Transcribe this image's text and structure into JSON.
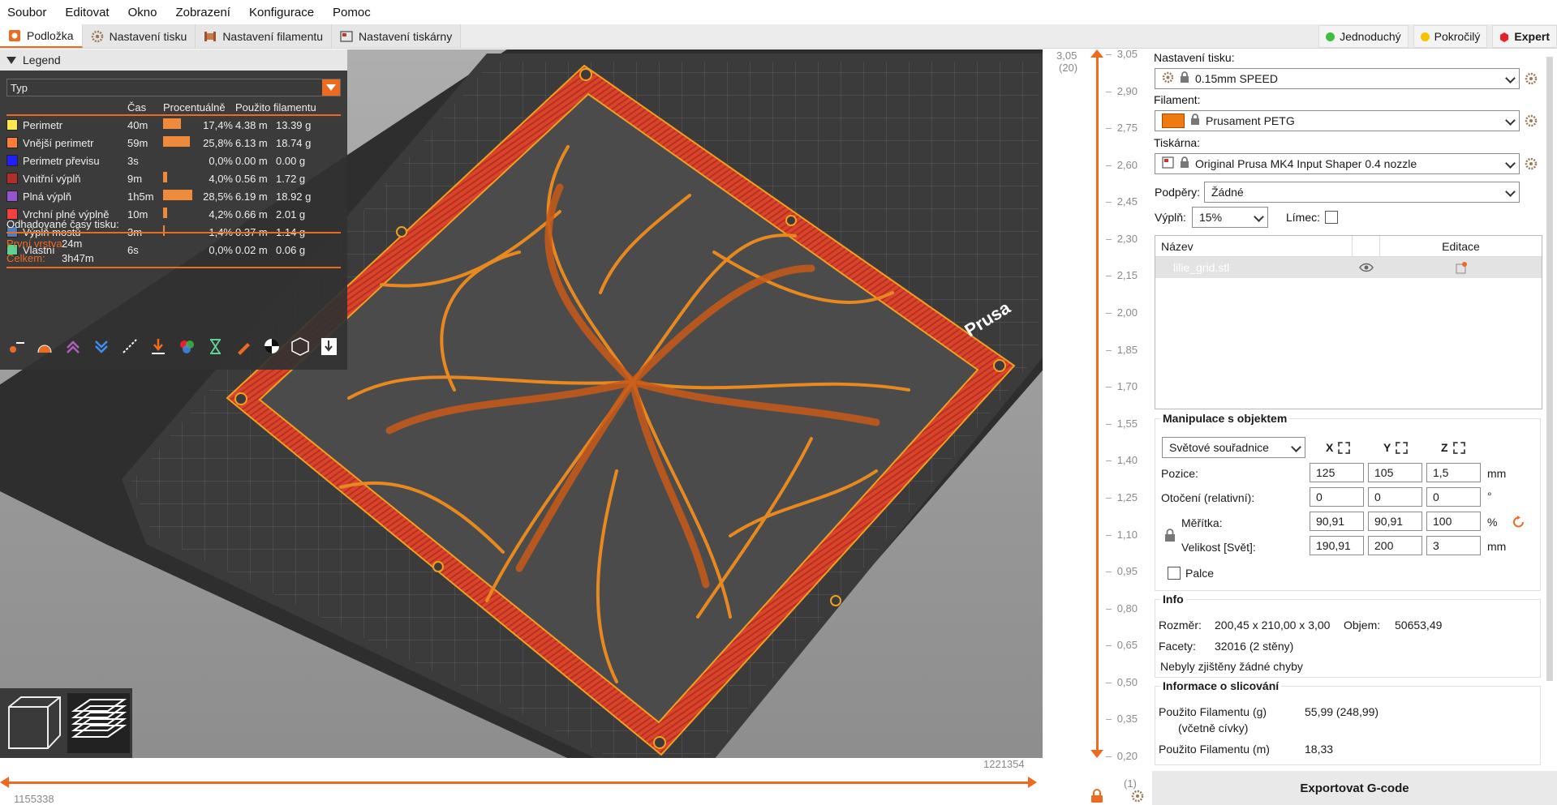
{
  "menu": [
    "Soubor",
    "Editovat",
    "Okno",
    "Zobrazení",
    "Konfigurace",
    "Pomoc"
  ],
  "tabs": [
    {
      "label": "Podložka",
      "active": true
    },
    {
      "label": "Nastavení tisku",
      "active": false
    },
    {
      "label": "Nastavení filamentu",
      "active": false
    },
    {
      "label": "Nastavení tiskárny",
      "active": false
    }
  ],
  "modes": [
    {
      "label": "Jednoduchý",
      "color": "#3fbf3f"
    },
    {
      "label": "Pokročilý",
      "color": "#f5c400"
    },
    {
      "label": "Expert",
      "color": "#e8202a"
    }
  ],
  "legend": {
    "title": "Legend",
    "view_type": "Typ",
    "headers": {
      "time": "Čas",
      "percent": "Procentuálně",
      "filament": "Použito filamentu"
    },
    "rows": [
      {
        "name": "Perimetr",
        "color": "#ffe64a",
        "time": "40m",
        "percent": 17.4,
        "percent_label": "17,4%",
        "meters": "4.38 m",
        "grams": "13.39 g"
      },
      {
        "name": "Vnější perimetr",
        "color": "#ff7d38",
        "time": "59m",
        "percent": 25.8,
        "percent_label": "25,8%",
        "meters": "6.13 m",
        "grams": "18.74 g"
      },
      {
        "name": "Perimetr převisu",
        "color": "#1f1fff",
        "time": "3s",
        "percent": 0.0,
        "percent_label": "0,0%",
        "meters": "0.00 m",
        "grams": "0.00 g"
      },
      {
        "name": "Vnitřní výplň",
        "color": "#b03029",
        "time": "9m",
        "percent": 4.0,
        "percent_label": "4,0%",
        "meters": "0.56 m",
        "grams": "1.72 g"
      },
      {
        "name": "Plná výplň",
        "color": "#9654cc",
        "time": "1h5m",
        "percent": 28.5,
        "percent_label": "28,5%",
        "meters": "6.19 m",
        "grams": "18.92 g"
      },
      {
        "name": "Vrchní plné výplně",
        "color": "#f04040",
        "time": "10m",
        "percent": 4.2,
        "percent_label": "4,2%",
        "meters": "0.66 m",
        "grams": "2.01 g"
      },
      {
        "name": "Výplň mostů",
        "color": "#4d80ba",
        "time": "3m",
        "percent": 1.4,
        "percent_label": "1,4%",
        "meters": "0.37 m",
        "grams": "1.14 g"
      },
      {
        "name": "Vlastní",
        "color": "#5ed194",
        "time": "6s",
        "percent": 0.0,
        "percent_label": "0,0%",
        "meters": "0.02 m",
        "grams": "0.06 g"
      }
    ],
    "estimated_label": "Odhadované časy tisku:",
    "first_layer_label": "První vrstva:",
    "first_layer_value": "24m",
    "total_label": "Celkem:",
    "total_value": "3h47m"
  },
  "viewport": {
    "bed_brand": "Prusa",
    "move_min": "1155338",
    "move_max": "1221354"
  },
  "ruler": {
    "top_value": "3,05",
    "top_layer": "(20)",
    "bottom_value": "0,20",
    "bottom_layer": "(1)",
    "ticks": [
      "3,05",
      "2,90",
      "2,75",
      "2,60",
      "2,45",
      "2,30",
      "2,15",
      "2,00",
      "1,85",
      "1,70",
      "1,55",
      "1,40",
      "1,25",
      "1,10",
      "0,95",
      "0,80",
      "0,65",
      "0,50",
      "0,35",
      "0,20"
    ]
  },
  "panel": {
    "print_label": "Nastavení tisku:",
    "print_value": "0.15mm SPEED",
    "filament_label": "Filament:",
    "filament_value": "Prusament PETG",
    "filament_color": "#f07a12",
    "printer_label": "Tiskárna:",
    "printer_value": "Original Prusa MK4 Input Shaper 0.4 nozzle",
    "supports_label": "Podpěry:",
    "supports_value": "Žádné",
    "infill_label": "Výplň:",
    "infill_value": "15%",
    "brim_label": "Límec:",
    "objlist": {
      "col_name": "Název",
      "col_edit": "Editace",
      "object_name": "lilie_grid.stl"
    },
    "manip": {
      "title": "Manipulace s objektem",
      "coords": "Světové souřadnice",
      "axes": [
        "X",
        "Y",
        "Z"
      ],
      "position_label": "Pozice:",
      "position": [
        "125",
        "105",
        "1,5"
      ],
      "position_unit": "mm",
      "rotation_label": "Otočení (relativní):",
      "rotation": [
        "0",
        "0",
        "0"
      ],
      "rotation_unit": "°",
      "scale_label": "Měřítka:",
      "scale": [
        "90,91",
        "90,91",
        "100"
      ],
      "scale_unit": "%",
      "size_label": "Velikost [Svět]:",
      "size": [
        "190,91",
        "200",
        "3"
      ],
      "size_unit": "mm",
      "inches_label": "Palce"
    },
    "info": {
      "title": "Info",
      "size_label": "Rozměr:",
      "size_value": "200,45 x 210,00 x 3,00",
      "volume_label": "Objem:",
      "volume_value": "50653,49",
      "facets_label": "Facety:",
      "facets_value": "32016 (2 stěny)",
      "errors": "Nebyly zjištěny žádné chyby"
    },
    "slice": {
      "title": "Informace o slicování",
      "used_g_label": "Použito Filamentu (g)",
      "used_g_sub": "(včetně cívky)",
      "used_g_value": "55,99 (248,99)",
      "used_m_label": "Použito Filamentu (m)",
      "used_m_value": "18,33"
    },
    "export_label": "Exportovat G-code"
  }
}
